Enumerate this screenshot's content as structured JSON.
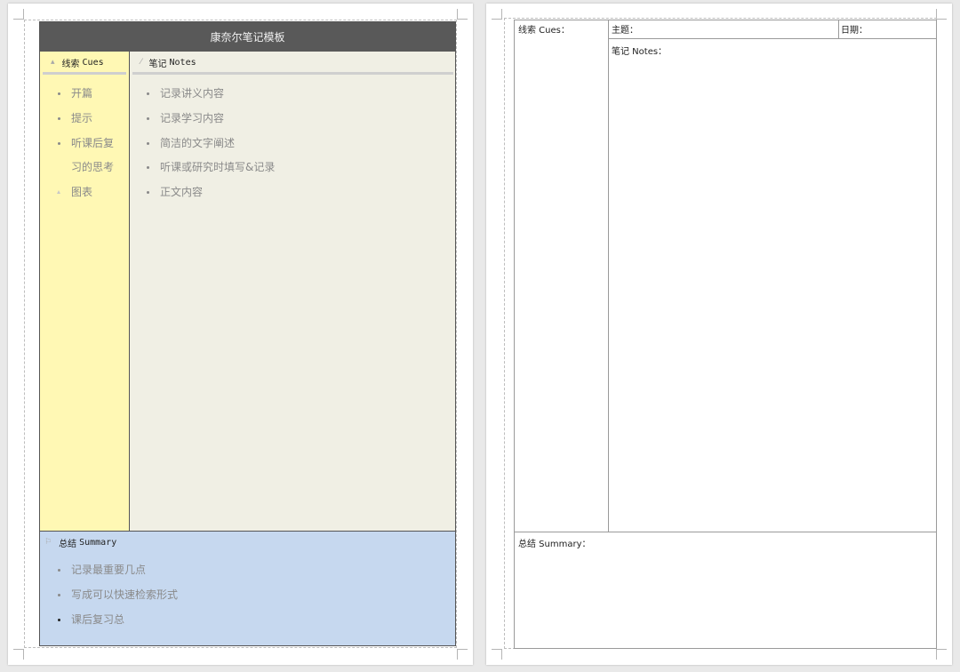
{
  "page1": {
    "header_title": "康奈尔笔记模板",
    "cues": {
      "title_zh": "线索",
      "title_en": "Cues",
      "items": [
        "开篇",
        "提示",
        "听课后复",
        "习的思考",
        "图表"
      ]
    },
    "notes": {
      "title_zh": "笔记",
      "title_en": "Notes",
      "items": [
        "记录讲义内容",
        "记录学习内容",
        "简洁的文字阐述",
        "听课或研究时填写&记录",
        "正文内容"
      ]
    },
    "summary": {
      "title_zh": "总结",
      "title_en": "Summary",
      "items": [
        "记录最重要几点",
        "写成可以快速检索形式",
        "课后复习总"
      ]
    },
    "colors": {
      "header_bg": "#595959",
      "cues_bg": "#fff8b4",
      "notes_bg": "#f0efe4",
      "summary_bg": "#c6d8ef"
    }
  },
  "page2": {
    "cues_label": "线索 Cues：",
    "topic_label": "主题：",
    "date_label": "日期：",
    "notes_label": "笔记 Notes：",
    "summary_label": "总结 Summary："
  }
}
